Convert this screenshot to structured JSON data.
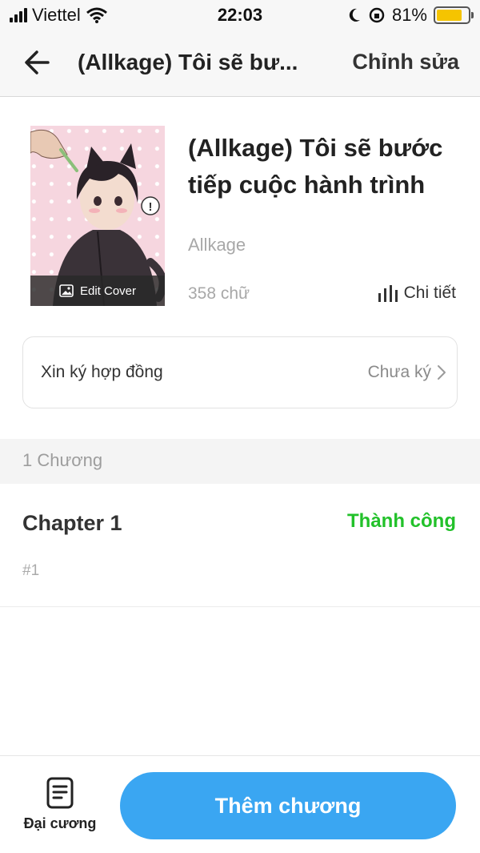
{
  "status_bar": {
    "carrier": "Viettel",
    "time": "22:03",
    "battery": "81%",
    "battery_level": 0.81,
    "icons": [
      "signal-icon",
      "wifi-icon",
      "moon-icon",
      "orientation-lock-icon",
      "battery-icon"
    ]
  },
  "nav": {
    "title": "(Allkage) Tôi sẽ bư...",
    "edit_label": "Chỉnh sửa",
    "back_icon": "arrow-left-icon"
  },
  "book": {
    "title": "(Allkage) Tôi sẽ bước tiếp cuộc hành trình",
    "author": "Allkage",
    "word_count": "358 chữ",
    "detail_label": "Chi tiết",
    "edit_cover_label": "Edit Cover",
    "cover_bg_color": "#f6d6df"
  },
  "contract": {
    "label": "Xin ký hợp đồng",
    "status": "Chưa ký"
  },
  "chapters": {
    "count_label": "1 Chương",
    "items": [
      {
        "title": "Chapter 1",
        "status": "Thành công",
        "number": "#1"
      }
    ]
  },
  "bottom": {
    "outline_label": "Đại cương",
    "add_chapter_label": "Thêm chương",
    "accent_color": "#3aa6f2",
    "success_color": "#22c12a"
  }
}
